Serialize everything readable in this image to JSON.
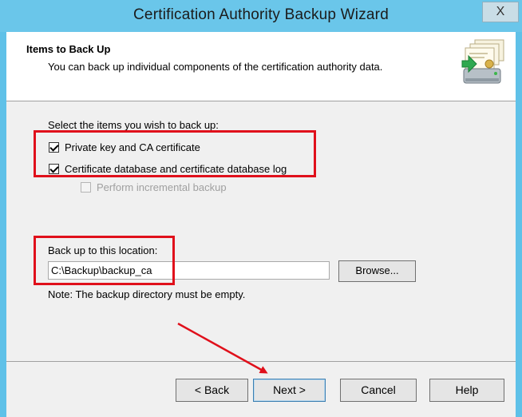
{
  "window": {
    "title": "Certification Authority Backup Wizard",
    "close_label": "X"
  },
  "header": {
    "title": "Items to Back Up",
    "subtitle": "You can back up individual components of the certification authority data.",
    "icon": "backup-certificate-icon"
  },
  "items": {
    "prompt": "Select the items you wish to back up:",
    "options": [
      {
        "label": "Private key and CA certificate",
        "checked": true,
        "enabled": true
      },
      {
        "label": "Certificate database and certificate database log",
        "checked": true,
        "enabled": true
      },
      {
        "label": "Perform incremental backup",
        "checked": false,
        "enabled": false
      }
    ]
  },
  "location": {
    "label": "Back up to this location:",
    "value": "C:\\Backup\\backup_ca",
    "browse_label": "Browse...",
    "note": "Note: The backup directory must be empty."
  },
  "buttons": {
    "back": "< Back",
    "next": "Next >",
    "cancel": "Cancel",
    "help": "Help"
  },
  "annotation_color": "#e0101b"
}
